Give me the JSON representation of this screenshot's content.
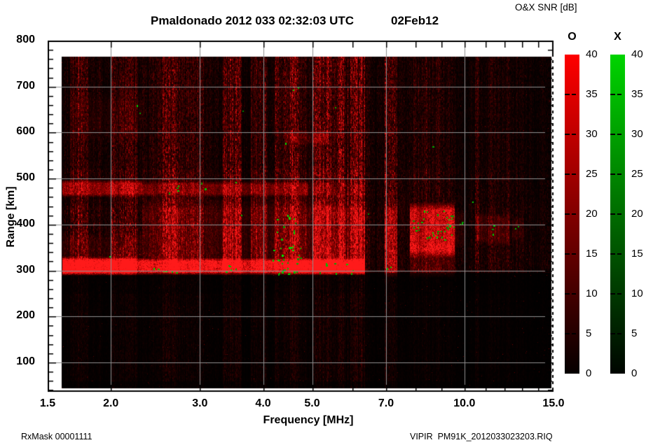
{
  "title": {
    "station_time": "Pmaldonado 2012 033 02:32:03 UTC",
    "date": "02Feb12"
  },
  "footer": {
    "rx_mask": "RxMask 00001111",
    "file_info": "VIPIR  PM91K_2012033023203.RIQ"
  },
  "chart_data": {
    "type": "heatmap",
    "title": "Pmaldonado 2012 033 02:32:03 UTC 02Feb12",
    "station": "Pmaldonado",
    "timestamp_utc": "2012 033 02:32:03 UTC",
    "date_label": "02Feb12",
    "xlabel": "Frequency [MHz]",
    "ylabel": "Range [km]",
    "x_scale": "log",
    "grid": true,
    "x_axis": {
      "min_mhz": 1.5,
      "max_mhz": 15.0,
      "major_ticks": [
        {
          "v": 1.5,
          "label": "1.5"
        },
        {
          "v": 2.0,
          "label": "2.0"
        },
        {
          "v": 3.0,
          "label": "3.0"
        },
        {
          "v": 4.0,
          "label": "4.0"
        },
        {
          "v": 5.0,
          "label": "5.0"
        },
        {
          "v": 7.0,
          "label": "7.0"
        },
        {
          "v": 10.0,
          "label": "10.0"
        },
        {
          "v": 15.0,
          "label": "15.0"
        }
      ],
      "minor_ticks": [
        6.0,
        8.0,
        9.0,
        11.0,
        12.0,
        13.0,
        14.0
      ]
    },
    "y_axis": {
      "min_km": 36,
      "max_km": 800,
      "major_ticks": [
        100,
        200,
        300,
        400,
        500,
        600,
        700,
        800
      ],
      "minor_step_km": 20
    },
    "legend": {
      "title": "O&X SNR [dB]",
      "min_db": 0,
      "max_db": 40,
      "tick_step_db": 5,
      "bars": [
        {
          "label": "O",
          "top_color": "#fe0000",
          "bottom_color": "#050000"
        },
        {
          "label": "X",
          "top_color": "#00d400",
          "bottom_color": "#000500"
        }
      ]
    },
    "data_extent": {
      "freq_start_mhz": 1.6,
      "freq_end_mhz": 15.0,
      "range_start_km": 44,
      "range_end_km": 765
    },
    "echo_summary": {
      "f_layer_trace_km": 305,
      "trace_freq_span_mhz": [
        1.6,
        6.35
      ],
      "second_hop_km": 478,
      "fof2_patch_mhz": [
        7.8,
        9.55
      ],
      "fof2_patch_km": [
        345,
        432
      ]
    },
    "noise_bands": [
      [
        1.6,
        1.66,
        0.1
      ],
      [
        1.66,
        1.8,
        0.3
      ],
      [
        1.8,
        1.92,
        0.16
      ],
      [
        1.92,
        2.0,
        0.1
      ],
      [
        2.0,
        2.25,
        0.3
      ],
      [
        2.25,
        2.38,
        0.15
      ],
      [
        2.38,
        2.52,
        0.22
      ],
      [
        2.52,
        2.72,
        0.45
      ],
      [
        2.72,
        3.05,
        0.28
      ],
      [
        3.05,
        3.32,
        0.12
      ],
      [
        3.32,
        3.62,
        0.45
      ],
      [
        3.62,
        3.78,
        0.08
      ],
      [
        3.78,
        4.08,
        0.28
      ],
      [
        4.08,
        4.2,
        0.1
      ],
      [
        4.2,
        4.52,
        0.32
      ],
      [
        4.52,
        4.72,
        0.5
      ],
      [
        4.72,
        4.88,
        0.25
      ],
      [
        4.88,
        5.02,
        0.15
      ],
      [
        5.02,
        5.45,
        0.55
      ],
      [
        5.45,
        5.62,
        0.35
      ],
      [
        5.62,
        5.8,
        0.6
      ],
      [
        5.8,
        5.95,
        0.3
      ],
      [
        5.95,
        6.35,
        0.5
      ],
      [
        6.35,
        6.55,
        0.18
      ],
      [
        6.55,
        6.95,
        0.1
      ],
      [
        6.95,
        7.35,
        0.4
      ],
      [
        7.35,
        7.8,
        0.12
      ],
      [
        7.8,
        8.2,
        0.18
      ],
      [
        8.2,
        9.0,
        0.2
      ],
      [
        9.0,
        9.6,
        0.14
      ],
      [
        9.6,
        10.2,
        0.08
      ],
      [
        10.2,
        10.48,
        0.12
      ],
      [
        10.48,
        10.65,
        0.28
      ],
      [
        10.65,
        11.1,
        0.1
      ],
      [
        11.1,
        12.3,
        0.16
      ],
      [
        12.3,
        13.2,
        0.12
      ],
      [
        13.2,
        15.0,
        0.08
      ]
    ],
    "echo_features": [
      {
        "f0": 1.6,
        "f1": 6.35,
        "r0": 298,
        "r1": 320,
        "amp": 1.0,
        "s": 8
      },
      {
        "f0": 1.6,
        "f1": 2.25,
        "r0": 297,
        "r1": 324,
        "amp": 0.55,
        "s": 8
      },
      {
        "f0": 4.5,
        "f1": 6.35,
        "r0": 298,
        "r1": 318,
        "amp": 0.4,
        "s": 8
      },
      {
        "f0": 2.3,
        "f1": 6.35,
        "r0": 320,
        "r1": 432,
        "amp": 0.26,
        "s": 30
      },
      {
        "f0": 1.6,
        "f1": 2.3,
        "r0": 320,
        "r1": 365,
        "amp": 0.18,
        "s": 20
      },
      {
        "f0": 1.6,
        "f1": 2.3,
        "r0": 468,
        "r1": 490,
        "amp": 0.55,
        "s": 8
      },
      {
        "f0": 2.3,
        "f1": 4.9,
        "r0": 468,
        "r1": 487,
        "amp": 0.38,
        "s": 8
      },
      {
        "f0": 4.9,
        "f1": 6.35,
        "r0": 466,
        "r1": 486,
        "amp": 0.16,
        "s": 8
      },
      {
        "f0": 6.95,
        "f1": 7.35,
        "r0": 300,
        "r1": 430,
        "amp": 0.38,
        "s": 15
      },
      {
        "f0": 7.8,
        "f1": 9.55,
        "r0": 345,
        "r1": 432,
        "amp": 0.72,
        "s": 18
      },
      {
        "f0": 7.8,
        "f1": 9.55,
        "r0": 300,
        "r1": 348,
        "amp": 0.25,
        "s": 15
      },
      {
        "f0": 9.55,
        "f1": 10.0,
        "r0": 360,
        "r1": 420,
        "amp": 0.22,
        "s": 12
      },
      {
        "f0": 10.55,
        "f1": 11.05,
        "r0": 368,
        "r1": 416,
        "amp": 0.33,
        "s": 10
      },
      {
        "f0": 11.1,
        "f1": 12.25,
        "r0": 365,
        "r1": 415,
        "amp": 0.28,
        "s": 12
      },
      {
        "f0": 12.4,
        "f1": 13.1,
        "r0": 372,
        "r1": 408,
        "amp": 0.2,
        "s": 10
      },
      {
        "f0": 4.4,
        "f1": 5.35,
        "r0": 580,
        "r1": 598,
        "amp": 0.2,
        "s": 8
      },
      {
        "f0": 1.66,
        "f1": 2.3,
        "r0": 600,
        "r1": 668,
        "amp": 0.1,
        "s": 20
      }
    ],
    "green_clusters": [
      {
        "f0": 4.15,
        "f1": 4.78,
        "r0": 293,
        "r1": 355,
        "n": 30
      },
      {
        "f0": 4.25,
        "f1": 4.62,
        "r0": 355,
        "r1": 425,
        "n": 12
      },
      {
        "f0": 8.2,
        "f1": 9.5,
        "r0": 368,
        "r1": 432,
        "n": 30
      },
      {
        "f0": 7.75,
        "f1": 8.15,
        "r0": 385,
        "r1": 425,
        "n": 6
      },
      {
        "f0": 2.4,
        "f1": 2.72,
        "r0": 294,
        "r1": 312,
        "n": 6
      },
      {
        "f0": 2.55,
        "f1": 2.72,
        "r0": 468,
        "r1": 486,
        "n": 4
      },
      {
        "f0": 3.35,
        "f1": 3.62,
        "r0": 294,
        "r1": 312,
        "n": 5
      },
      {
        "f0": 5.05,
        "f1": 6.3,
        "r0": 292,
        "r1": 316,
        "n": 8
      },
      {
        "f0": 9.7,
        "f1": 10.1,
        "r0": 388,
        "r1": 412,
        "n": 3
      },
      {
        "f0": 11.3,
        "f1": 11.6,
        "r0": 380,
        "r1": 402,
        "n": 3
      },
      {
        "f0": 12.5,
        "f1": 12.8,
        "r0": 382,
        "r1": 398,
        "n": 2
      },
      {
        "f0": 2.15,
        "f1": 2.32,
        "r0": 638,
        "r1": 662,
        "n": 2
      },
      {
        "f0": 4.5,
        "f1": 4.75,
        "r0": 693,
        "r1": 712,
        "n": 2
      },
      {
        "f0": 2.95,
        "f1": 3.12,
        "r0": 476,
        "r1": 492,
        "n": 2
      },
      {
        "f0": 8.6,
        "f1": 8.9,
        "r0": 570,
        "r1": 590,
        "n": 1
      },
      {
        "f0": 6.9,
        "f1": 7.15,
        "r0": 298,
        "r1": 314,
        "n": 2
      },
      {
        "f0": 4.3,
        "f1": 4.52,
        "r0": 568,
        "r1": 586,
        "n": 1
      },
      {
        "f0": 3.5,
        "f1": 3.7,
        "r0": 482,
        "r1": 492,
        "n": 1
      }
    ],
    "render_seed": 1320
  }
}
